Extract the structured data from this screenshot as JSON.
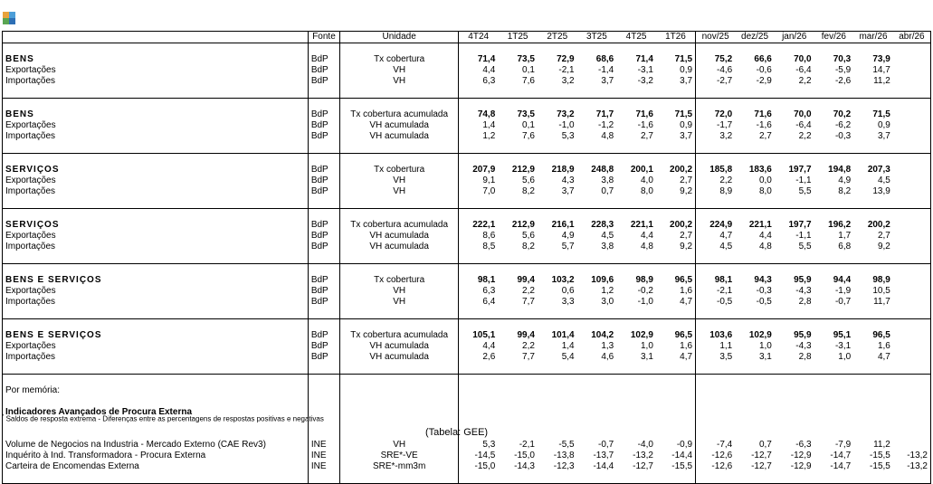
{
  "header": {
    "fonte": "Fonte",
    "unidade": "Unidade",
    "periods": [
      "4T24",
      "1T25",
      "2T25",
      "3T25",
      "4T25",
      "1T26",
      "nov/25",
      "dez/25",
      "jan/26",
      "fev/26",
      "mar/26",
      "abr/26"
    ]
  },
  "sections": [
    {
      "rows": [
        {
          "name": "BENS",
          "src": "BdP",
          "unit": "Tx cobertura",
          "v": [
            "71,4",
            "73,5",
            "72,9",
            "68,6",
            "71,4",
            "71,5",
            "75,2",
            "66,6",
            "70,0",
            "70,3",
            "73,9",
            ""
          ],
          "bold": true
        },
        {
          "name": "Exportações",
          "src": "BdP",
          "unit": "VH",
          "v": [
            "4,4",
            "0,1",
            "-2,1",
            "-1,4",
            "-3,1",
            "0,9",
            "-4,6",
            "-0,6",
            "-6,4",
            "-5,9",
            "14,7",
            ""
          ]
        },
        {
          "name": "Importações",
          "src": "BdP",
          "unit": "VH",
          "v": [
            "6,3",
            "7,6",
            "3,2",
            "3,7",
            "-3,2",
            "3,7",
            "-2,7",
            "-2,9",
            "2,2",
            "-2,6",
            "11,2",
            ""
          ]
        }
      ]
    },
    {
      "rows": [
        {
          "name": "BENS",
          "src": "BdP",
          "unit": "Tx cobertura acumulada",
          "v": [
            "74,8",
            "73,5",
            "73,2",
            "71,7",
            "71,6",
            "71,5",
            "72,0",
            "71,6",
            "70,0",
            "70,2",
            "71,5",
            ""
          ],
          "bold": true
        },
        {
          "name": "Exportações",
          "src": "BdP",
          "unit": "VH acumulada",
          "v": [
            "1,4",
            "0,1",
            "-1,0",
            "-1,2",
            "-1,6",
            "0,9",
            "-1,7",
            "-1,6",
            "-6,4",
            "-6,2",
            "0,9",
            ""
          ]
        },
        {
          "name": "Importações",
          "src": "BdP",
          "unit": "VH acumulada",
          "v": [
            "1,2",
            "7,6",
            "5,3",
            "4,8",
            "2,7",
            "3,7",
            "3,2",
            "2,7",
            "2,2",
            "-0,3",
            "3,7",
            ""
          ]
        }
      ]
    },
    {
      "rows": [
        {
          "name": "SERVIÇOS",
          "src": "BdP",
          "unit": "Tx cobertura",
          "v": [
            "207,9",
            "212,9",
            "218,9",
            "248,8",
            "200,1",
            "200,2",
            "185,8",
            "183,6",
            "197,7",
            "194,8",
            "207,3",
            ""
          ],
          "bold": true
        },
        {
          "name": "Exportações",
          "src": "BdP",
          "unit": "VH",
          "v": [
            "9,1",
            "5,6",
            "4,3",
            "3,8",
            "4,0",
            "2,7",
            "2,2",
            "0,0",
            "-1,1",
            "4,9",
            "4,5",
            ""
          ]
        },
        {
          "name": "Importações",
          "src": "BdP",
          "unit": "VH",
          "v": [
            "7,0",
            "8,2",
            "3,7",
            "0,7",
            "8,0",
            "9,2",
            "8,9",
            "8,0",
            "5,5",
            "8,2",
            "13,9",
            ""
          ]
        }
      ]
    },
    {
      "rows": [
        {
          "name": "SERVIÇOS",
          "src": "BdP",
          "unit": "Tx cobertura acumulada",
          "v": [
            "222,1",
            "212,9",
            "216,1",
            "228,3",
            "221,1",
            "200,2",
            "224,9",
            "221,1",
            "197,7",
            "196,2",
            "200,2",
            ""
          ],
          "bold": true
        },
        {
          "name": "Exportações",
          "src": "BdP",
          "unit": "VH acumulada",
          "v": [
            "8,6",
            "5,6",
            "4,9",
            "4,5",
            "4,4",
            "2,7",
            "4,7",
            "4,4",
            "-1,1",
            "1,7",
            "2,7",
            ""
          ]
        },
        {
          "name": "Importações",
          "src": "BdP",
          "unit": "VH acumulada",
          "v": [
            "8,5",
            "8,2",
            "5,7",
            "3,8",
            "4,8",
            "9,2",
            "4,5",
            "4,8",
            "5,5",
            "6,8",
            "9,2",
            ""
          ]
        }
      ]
    },
    {
      "rows": [
        {
          "name": "BENS E SERVIÇOS",
          "src": "BdP",
          "unit": "Tx cobertura",
          "v": [
            "98,1",
            "99,4",
            "103,2",
            "109,6",
            "98,9",
            "96,5",
            "98,1",
            "94,3",
            "95,9",
            "94,4",
            "98,9",
            ""
          ],
          "bold": true
        },
        {
          "name": "Exportações",
          "src": "BdP",
          "unit": "VH",
          "v": [
            "6,3",
            "2,2",
            "0,6",
            "1,2",
            "-0,2",
            "1,6",
            "-2,1",
            "-0,3",
            "-4,3",
            "-1,9",
            "10,5",
            ""
          ]
        },
        {
          "name": "Importações",
          "src": "BdP",
          "unit": "VH",
          "v": [
            "6,4",
            "7,7",
            "3,3",
            "3,0",
            "-1,0",
            "4,7",
            "-0,5",
            "-0,5",
            "2,8",
            "-0,7",
            "11,7",
            ""
          ]
        }
      ]
    },
    {
      "rows": [
        {
          "name": "BENS E SERVIÇOS",
          "src": "BdP",
          "unit": "Tx cobertura acumulada",
          "v": [
            "105,1",
            "99,4",
            "101,4",
            "104,2",
            "102,9",
            "96,5",
            "103,6",
            "102,9",
            "95,9",
            "95,1",
            "96,5",
            ""
          ],
          "bold": true
        },
        {
          "name": "Exportações",
          "src": "BdP",
          "unit": "VH acumulada",
          "v": [
            "4,4",
            "2,2",
            "1,4",
            "1,3",
            "1,0",
            "1,6",
            "1,1",
            "1,0",
            "-4,3",
            "-3,1",
            "1,6",
            ""
          ]
        },
        {
          "name": "Importações",
          "src": "BdP",
          "unit": "VH acumulada",
          "v": [
            "2,6",
            "7,7",
            "5,4",
            "4,6",
            "3,1",
            "4,7",
            "3,5",
            "3,1",
            "2,8",
            "1,0",
            "4,7",
            ""
          ]
        }
      ]
    }
  ],
  "memo": {
    "label": "Por memória:",
    "subtitle": "Indicadores Avançados de Procura Externa",
    "rows": [
      {
        "name": "Volume de Negocios na Industria - Mercado Externo (CAE Rev3)",
        "src": "INE",
        "unit": "VH",
        "v": [
          "5,3",
          "-2,1",
          "-5,5",
          "-0,7",
          "-4,0",
          "-0,9",
          "-7,4",
          "0,7",
          "-6,3",
          "-7,9",
          "11,2",
          ""
        ]
      },
      {
        "name": "Inquérito à Ind. Transformadora - Procura Externa",
        "src": "INE",
        "unit": "SRE*-VE",
        "v": [
          "-14,5",
          "-15,0",
          "-13,8",
          "-13,7",
          "-13,2",
          "-14,4",
          "-12,6",
          "-12,7",
          "-12,9",
          "-14,7",
          "-15,5",
          "-13,2"
        ]
      },
      {
        "name": "Carteira de Encomendas Externa",
        "src": "INE",
        "unit": "SRE*-mm3m",
        "v": [
          "-15,0",
          "-14,3",
          "-12,3",
          "-14,4",
          "-12,7",
          "-15,5",
          "-12,6",
          "-12,7",
          "-12,9",
          "-14,7",
          "-15,5",
          "-13,2"
        ]
      }
    ]
  },
  "footnote": {
    "mark": "*",
    "text": " Saldos de resposta extrema - Diferenças entre as percentagens de respostas positivas e negativas"
  },
  "credit": "(Tabela: GEE)"
}
